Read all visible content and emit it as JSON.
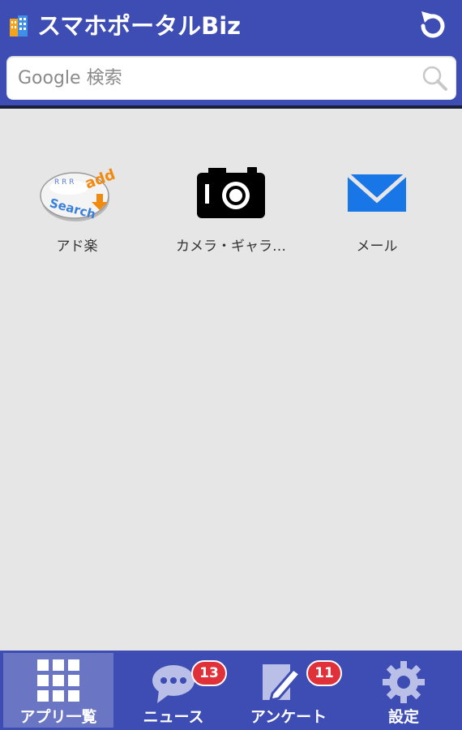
{
  "header": {
    "title": "スマホポータルBiz",
    "logo_icon": "building-icon",
    "refresh_icon": "refresh-icon"
  },
  "search": {
    "placeholder": "Google 検索",
    "value": "",
    "icon": "search-icon"
  },
  "apps": [
    {
      "label": "アド楽",
      "icon": "add-search-icon"
    },
    {
      "label": "カメラ・ギャラ…",
      "icon": "camera-icon"
    },
    {
      "label": "メール",
      "icon": "mail-icon"
    }
  ],
  "bottom_nav": [
    {
      "label": "アプリ一覧",
      "icon": "grid-icon",
      "active": true,
      "badge": ""
    },
    {
      "label": "ニュース",
      "icon": "chat-bubble-icon",
      "active": false,
      "badge": "13"
    },
    {
      "label": "アンケート",
      "icon": "survey-pen-icon",
      "active": false,
      "badge": "11"
    },
    {
      "label": "設定",
      "icon": "gear-icon",
      "active": false,
      "badge": ""
    }
  ],
  "colors": {
    "header_bg": "#3e4db3",
    "active_tab_bg": "#6a76c4",
    "badge": "#e0303a",
    "mail_blue": "#1976e6",
    "body_bg": "#e6e6e6"
  }
}
